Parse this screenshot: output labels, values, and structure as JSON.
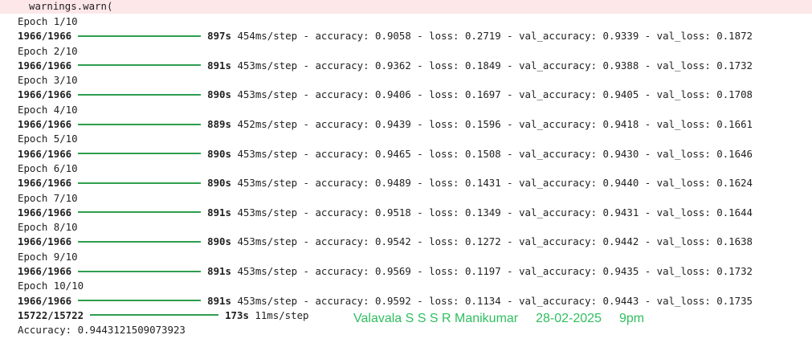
{
  "warning": {
    "text": "warnings.warn("
  },
  "epochs": [
    {
      "epoch": "Epoch 1/10",
      "steps": "1966/1966",
      "time": "897s",
      "per_step": "454ms/step",
      "rest": "- accuracy: 0.9058 - loss: 0.2719 - val_accuracy: 0.9339 - val_loss: 0.1872"
    },
    {
      "epoch": "Epoch 2/10",
      "steps": "1966/1966",
      "time": "891s",
      "per_step": "453ms/step",
      "rest": "- accuracy: 0.9362 - loss: 0.1849 - val_accuracy: 0.9388 - val_loss: 0.1732"
    },
    {
      "epoch": "Epoch 3/10",
      "steps": "1966/1966",
      "time": "890s",
      "per_step": "453ms/step",
      "rest": "- accuracy: 0.9406 - loss: 0.1697 - val_accuracy: 0.9405 - val_loss: 0.1708"
    },
    {
      "epoch": "Epoch 4/10",
      "steps": "1966/1966",
      "time": "889s",
      "per_step": "452ms/step",
      "rest": "- accuracy: 0.9439 - loss: 0.1596 - val_accuracy: 0.9418 - val_loss: 0.1661"
    },
    {
      "epoch": "Epoch 5/10",
      "steps": "1966/1966",
      "time": "890s",
      "per_step": "453ms/step",
      "rest": "- accuracy: 0.9465 - loss: 0.1508 - val_accuracy: 0.9430 - val_loss: 0.1646"
    },
    {
      "epoch": "Epoch 6/10",
      "steps": "1966/1966",
      "time": "890s",
      "per_step": "453ms/step",
      "rest": "- accuracy: 0.9489 - loss: 0.1431 - val_accuracy: 0.9440 - val_loss: 0.1624"
    },
    {
      "epoch": "Epoch 7/10",
      "steps": "1966/1966",
      "time": "891s",
      "per_step": "453ms/step",
      "rest": "- accuracy: 0.9518 - loss: 0.1349 - val_accuracy: 0.9431 - val_loss: 0.1644"
    },
    {
      "epoch": "Epoch 8/10",
      "steps": "1966/1966",
      "time": "890s",
      "per_step": "453ms/step",
      "rest": "- accuracy: 0.9542 - loss: 0.1272 - val_accuracy: 0.9442 - val_loss: 0.1638"
    },
    {
      "epoch": "Epoch 9/10",
      "steps": "1966/1966",
      "time": "891s",
      "per_step": "453ms/step",
      "rest": "- accuracy: 0.9569 - loss: 0.1197 - val_accuracy: 0.9435 - val_loss: 0.1732"
    },
    {
      "epoch": "Epoch 10/10",
      "steps": "1966/1966",
      "time": "891s",
      "per_step": "453ms/step",
      "rest": "- accuracy: 0.9592 - loss: 0.1134 - val_accuracy: 0.9443 - val_loss: 0.1735"
    }
  ],
  "evaluation": {
    "steps": "15722/15722",
    "time": "173s",
    "per_step": "11ms/step"
  },
  "accuracy_line": "Accuracy: 0.9443121509073923",
  "signature": {
    "name": "Valavala S S S R Manikumar",
    "date": "28-02-2025",
    "time": "9pm"
  },
  "colors": {
    "progress_bar": "#2e9e4f",
    "signature": "#2fbf5f",
    "warning_background": "#fde7e9"
  }
}
